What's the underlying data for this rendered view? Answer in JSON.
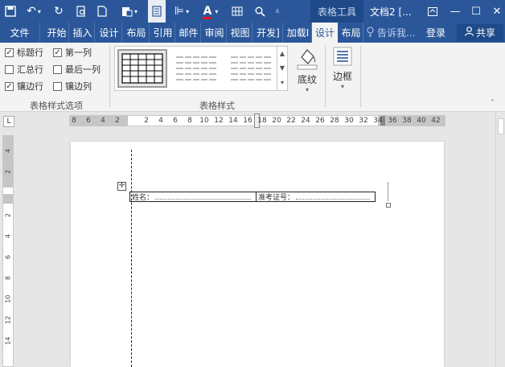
{
  "titlebar": {
    "context_tab": "表格工具",
    "doc_title": "文档2 [...",
    "icons": [
      "save-icon",
      "undo-icon",
      "redo-icon",
      "print-preview-icon",
      "new-doc-icon",
      "paste-icon",
      "view-icon",
      "paragraph-icon",
      "font-color-icon",
      "table-icon",
      "search-icon",
      "customize-icon"
    ],
    "window_icons": [
      "ribbon-display-icon",
      "minimize-icon",
      "maximize-icon",
      "close-icon"
    ]
  },
  "tabs": [
    {
      "label": "文件",
      "active": false
    },
    {
      "label": "开始",
      "active": false
    },
    {
      "label": "插入",
      "active": false
    },
    {
      "label": "设计",
      "active": false
    },
    {
      "label": "布局",
      "active": false
    },
    {
      "label": "引用",
      "active": false
    },
    {
      "label": "邮件",
      "active": false
    },
    {
      "label": "审阅",
      "active": false
    },
    {
      "label": "视图",
      "active": false
    },
    {
      "label": "开发]",
      "active": false
    },
    {
      "label": "加载I",
      "active": false
    },
    {
      "label": "设计",
      "active": true
    },
    {
      "label": "布局",
      "active": false
    }
  ],
  "tell_me": "告诉我...",
  "login": "登录",
  "share": "共享",
  "ribbon": {
    "style_options": {
      "label": "表格样式选项",
      "checkboxes": [
        {
          "label": "标题行",
          "checked": true
        },
        {
          "label": "第一列",
          "checked": true
        },
        {
          "label": "汇总行",
          "checked": false
        },
        {
          "label": "最后一列",
          "checked": false
        },
        {
          "label": "镶边行",
          "checked": true
        },
        {
          "label": "镶边列",
          "checked": false
        }
      ]
    },
    "table_styles": {
      "label": "表格样式"
    },
    "shading": {
      "label": "底纹"
    },
    "borders": {
      "label": "边框"
    }
  },
  "ruler": {
    "ticks_left": [
      "8",
      "6",
      "4",
      "2"
    ],
    "ticks_right": [
      "2",
      "4",
      "6",
      "8",
      "10",
      "12",
      "14",
      "16",
      "18",
      "20",
      "22",
      "24",
      "26",
      "28",
      "30",
      "32",
      "34",
      "36",
      "38",
      "40",
      "42"
    ]
  },
  "vruler": {
    "ticks": [
      "4",
      "2",
      "2",
      "4",
      "6",
      "8",
      "10",
      "12",
      "14"
    ]
  },
  "document": {
    "table": {
      "cells": [
        "姓名：",
        "准考证号："
      ]
    }
  },
  "colors": {
    "brand": "#2b579a",
    "ribbon": "#f3f3f3"
  }
}
